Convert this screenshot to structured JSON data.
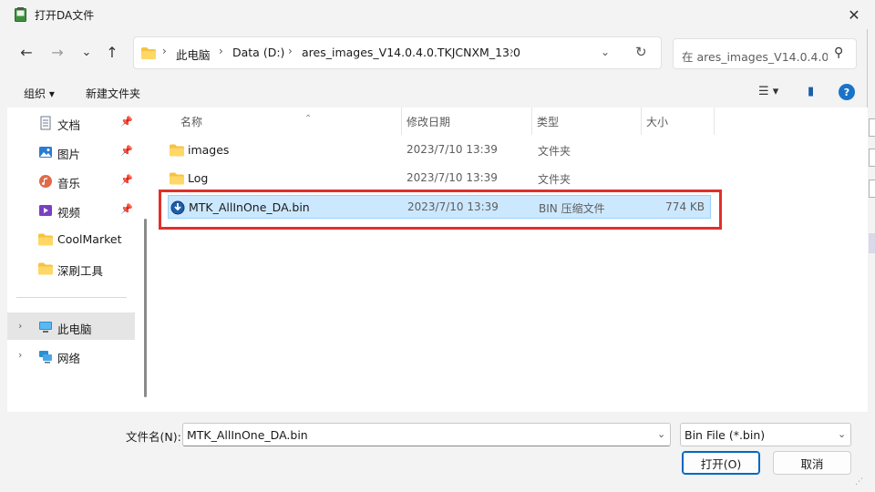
{
  "window": {
    "title": "打开DA文件",
    "close_label": "✕"
  },
  "nav": {
    "back_label": "←",
    "forward_label": "→",
    "recent_label": "⌄",
    "up_label": "↑",
    "breadcrumbs": [
      "此电脑",
      "Data (D:)",
      "ares_images_V14.0.4.0.TKJCNXM_13.0"
    ],
    "separator": "›",
    "dropdown_label": "⌄",
    "refresh_label": "↻",
    "search_placeholder": "在 ares_images_V14.0.4.0...",
    "search_icon": "⚲"
  },
  "toolbar": {
    "organize_label": "组织 ▾",
    "new_folder_label": "新建文件夹",
    "view_label": "☰ ▾",
    "pane_label": "▮",
    "help_label": "?"
  },
  "sidebar": {
    "items": [
      {
        "label": "文档",
        "icon": "document-icon",
        "pinned": "📌"
      },
      {
        "label": "图片",
        "icon": "pictures-icon",
        "pinned": "📌"
      },
      {
        "label": "音乐",
        "icon": "music-icon",
        "pinned": "📌"
      },
      {
        "label": "视频",
        "icon": "videos-icon",
        "pinned": "📌"
      },
      {
        "label": "CoolMarket",
        "icon": "folder-icon"
      },
      {
        "label": "深刷工具",
        "icon": "folder-icon"
      }
    ],
    "tree": [
      {
        "label": "此电脑",
        "icon": "computer-icon",
        "chevron": "›",
        "selected": true
      },
      {
        "label": "网络",
        "icon": "network-icon",
        "chevron": "›"
      }
    ]
  },
  "columns": {
    "name": "名称",
    "date": "修改日期",
    "type": "类型",
    "size": "大小",
    "sort_indicator": "⌃"
  },
  "files": [
    {
      "name": "images",
      "date": "2023/7/10 13:39",
      "type": "文件夹",
      "size": "",
      "icon": "folder-icon"
    },
    {
      "name": "Log",
      "date": "2023/7/10 13:39",
      "type": "文件夹",
      "size": "",
      "icon": "folder-icon"
    },
    {
      "name": "MTK_AllInOne_DA.bin",
      "date": "2023/7/10 13:39",
      "type": "BIN 压缩文件",
      "size": "774 KB",
      "icon": "bin-file-icon",
      "selected": true
    }
  ],
  "footer": {
    "filename_label": "文件名(N):",
    "filename_value": "MTK_AllInOne_DA.bin",
    "filter_value": "Bin File (*.bin)",
    "dropdown_chev": "⌄",
    "open_label": "打开(O)",
    "cancel_label": "取消"
  },
  "colors": {
    "accent": "#0067c0",
    "selection": "#cce8ff",
    "highlight_box": "#e0302a",
    "folder": "#f5c342"
  }
}
